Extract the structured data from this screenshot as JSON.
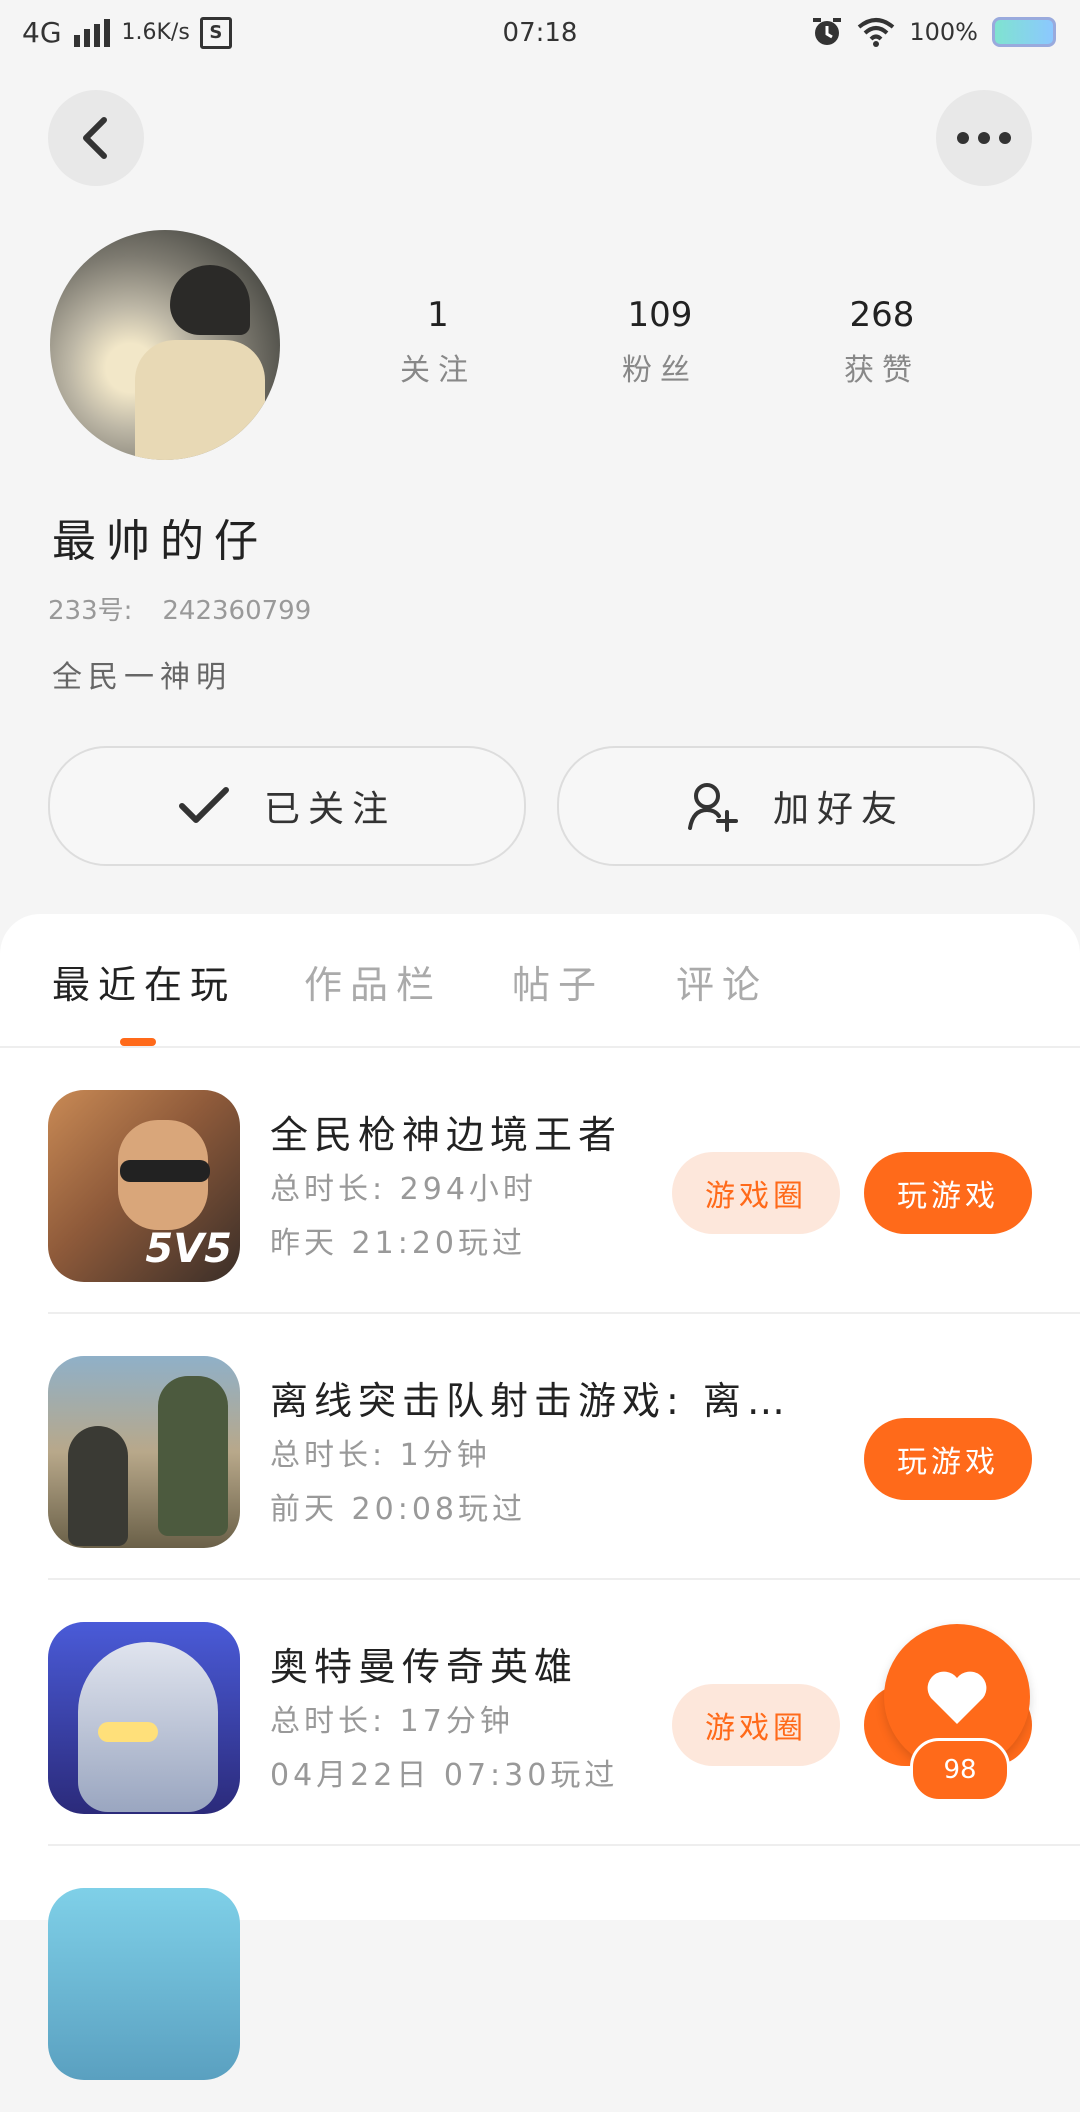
{
  "status_bar": {
    "network": "4G",
    "speed": "1.6K/s",
    "time": "07:18",
    "battery": "100%"
  },
  "profile": {
    "stats": [
      {
        "value": "1",
        "label": "关注"
      },
      {
        "value": "109",
        "label": "粉丝"
      },
      {
        "value": "268",
        "label": "获赞"
      }
    ],
    "name": "最帅的仔",
    "id_label": "233号:",
    "id_value": "242360799",
    "bio": "全民一神明",
    "follow_label": "已关注",
    "add_friend_label": "加好友"
  },
  "tabs": [
    {
      "label": "最近在玩",
      "active": true
    },
    {
      "label": "作品栏",
      "active": false
    },
    {
      "label": "帖子",
      "active": false
    },
    {
      "label": "评论",
      "active": false
    }
  ],
  "games": [
    {
      "title": "全民枪神边境王者",
      "duration": "总时长: 294小时",
      "last_played": "昨天 21:20玩过",
      "circle_label": "游戏圈",
      "play_label": "玩游戏",
      "icon_badge": "5V5"
    },
    {
      "title": "离线突击队射击游戏: 离…",
      "duration": "总时长: 1分钟",
      "last_played": "前天 20:08玩过",
      "play_label": "玩游戏"
    },
    {
      "title": "奥特曼传奇英雄",
      "duration": "总时长: 17分钟",
      "last_played": "04月22日 07:30玩过",
      "circle_label": "游戏圈",
      "play_label": "玩游戏"
    }
  ],
  "floating_like": {
    "count": "98"
  },
  "colors": {
    "accent": "#ff6a1a",
    "accent_light": "#fde7db",
    "background": "#f5f5f5"
  }
}
